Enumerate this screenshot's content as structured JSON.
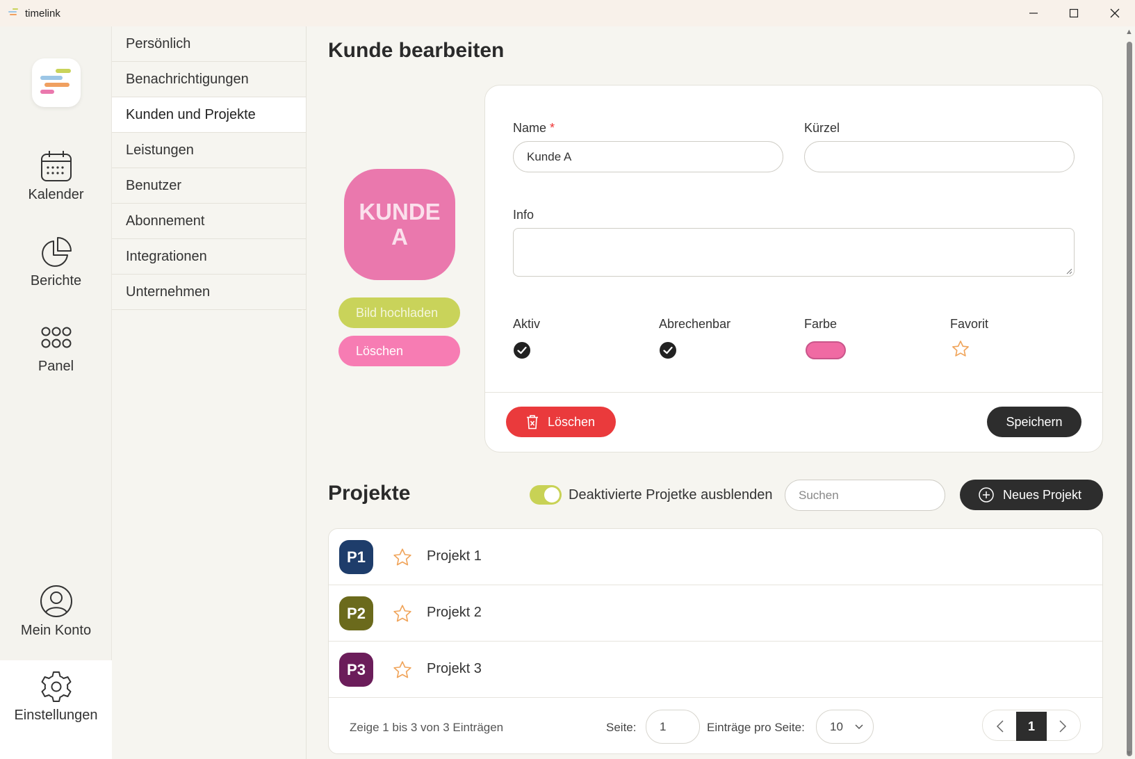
{
  "window": {
    "title": "timelink",
    "controls": {
      "minimize": "—",
      "maximize": "☐",
      "close": "✕"
    }
  },
  "rail": {
    "items": [
      {
        "label": "Kalender",
        "icon": "calendar-icon"
      },
      {
        "label": "Berichte",
        "icon": "pie-chart-icon"
      },
      {
        "label": "Panel",
        "icon": "grid-icon"
      },
      {
        "label": "Mein Konto",
        "icon": "user-circle-icon"
      },
      {
        "label": "Einstellungen",
        "icon": "gear-icon",
        "active": true
      }
    ]
  },
  "settings_menu": {
    "items": [
      {
        "label": "Persönlich"
      },
      {
        "label": "Benachrichtigungen"
      },
      {
        "label": "Kunden und Projekte",
        "active": true
      },
      {
        "label": "Leistungen"
      },
      {
        "label": "Benutzer"
      },
      {
        "label": "Abonnement"
      },
      {
        "label": "Integrationen"
      },
      {
        "label": "Unternehmen"
      }
    ]
  },
  "main": {
    "title": "Kunde bearbeiten",
    "avatar": {
      "text": "KUNDE A",
      "color": "#ea78ad"
    },
    "upload_label": "Bild hochladen",
    "delete_image_label": "Löschen",
    "form": {
      "name_label": "Name",
      "required_mark": "*",
      "name_value": "Kunde A",
      "short_label": "Kürzel",
      "short_value": "",
      "info_label": "Info",
      "info_value": "",
      "active_label": "Aktiv",
      "active_checked": true,
      "billable_label": "Abrechenbar",
      "billable_checked": true,
      "color_label": "Farbe",
      "color_value": "#f06aa3",
      "favorite_label": "Favorit",
      "favorite": false,
      "delete_label": "Löschen",
      "save_label": "Speichern"
    },
    "projects": {
      "title": "Projekte",
      "toggle_label": "Deaktivierte Projetke ausblenden",
      "toggle_on": true,
      "search_placeholder": "Suchen",
      "new_label": "Neues Projekt",
      "rows": [
        {
          "badge": "P1",
          "name": "Projekt 1",
          "color": "#1e3d6b"
        },
        {
          "badge": "P2",
          "name": "Projekt 2",
          "color": "#6b6a1c"
        },
        {
          "badge": "P3",
          "name": "Projekt 3",
          "color": "#6b1d5a"
        }
      ],
      "footer": {
        "info": "Zeige 1 bis 3 von 3 Einträgen",
        "page_label": "Seite:",
        "page_value": "1",
        "per_page_label": "Einträge pro Seite:",
        "per_page_value": "10",
        "current_page": "1"
      }
    }
  }
}
